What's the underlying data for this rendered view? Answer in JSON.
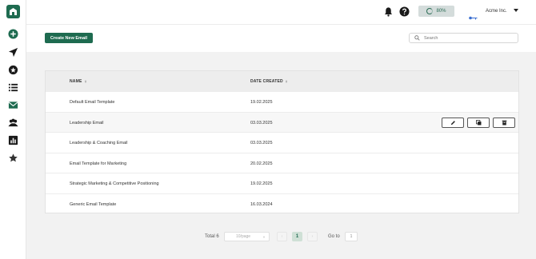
{
  "header": {
    "progress_label": "80%",
    "progress_value": 0.8,
    "org_name": "Acme Inc."
  },
  "toolbar": {
    "create_label": "Create New Email",
    "search_placeholder": "Search"
  },
  "table": {
    "columns": [
      "NAME",
      "DATE CREATED"
    ],
    "rows": [
      {
        "name": "Default Email Template",
        "date": "19.02.2025"
      },
      {
        "name": "Leadership Email",
        "date": "03.03.2025"
      },
      {
        "name": "Leadership & Coaching Email",
        "date": "03.03.2025"
      },
      {
        "name": "Email Template for Marketing",
        "date": "20.02.2025"
      },
      {
        "name": "Strategic Marketing & Competitive Positioning",
        "date": "19.02.2025"
      },
      {
        "name": "Generic Email Template",
        "date": "16.03.2024"
      }
    ]
  },
  "pagination": {
    "total_label": "Total 6",
    "page_size": "10/page",
    "prev": "‹",
    "next": "›",
    "current_page": "1",
    "goto_label": "Go to",
    "goto_value": "1"
  },
  "colors": {
    "brand": "#1e6b50",
    "progress_bg": "#d4dcdb"
  }
}
